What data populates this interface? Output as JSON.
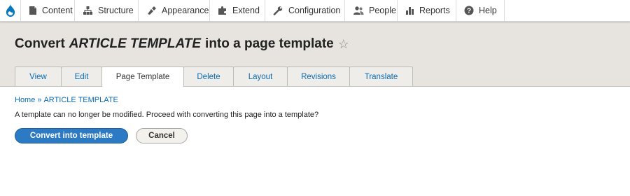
{
  "toolbar": {
    "items": [
      {
        "label": "Content",
        "icon": "content-icon"
      },
      {
        "label": "Structure",
        "icon": "structure-icon"
      },
      {
        "label": "Appearance",
        "icon": "appearance-icon"
      },
      {
        "label": "Extend",
        "icon": "extend-icon"
      },
      {
        "label": "Configuration",
        "icon": "configuration-icon"
      },
      {
        "label": "People",
        "icon": "people-icon"
      },
      {
        "label": "Reports",
        "icon": "reports-icon"
      },
      {
        "label": "Help",
        "icon": "help-icon"
      }
    ]
  },
  "header": {
    "title_prefix": "Convert",
    "title_emphasis": "ARTICLE TEMPLATE",
    "title_suffix": "into a page template",
    "tabs": [
      {
        "label": "View",
        "active": false
      },
      {
        "label": "Edit",
        "active": false
      },
      {
        "label": "Page Template",
        "active": true
      },
      {
        "label": "Delete",
        "active": false
      },
      {
        "label": "Layout",
        "active": false
      },
      {
        "label": "Revisions",
        "active": false
      },
      {
        "label": "Translate",
        "active": false
      }
    ]
  },
  "breadcrumb": {
    "home": "Home",
    "separator": "»",
    "current": "ARTICLE TEMPLATE"
  },
  "main": {
    "message": "A template can no longer be modified. Proceed with converting this page into a template?",
    "primary_button": "Convert into template",
    "cancel_button": "Cancel"
  },
  "colors": {
    "accent": "#2c7ac4",
    "link": "#0a6bb3",
    "header_bg": "#e7e4df",
    "drupal_blue": "#0678be"
  }
}
